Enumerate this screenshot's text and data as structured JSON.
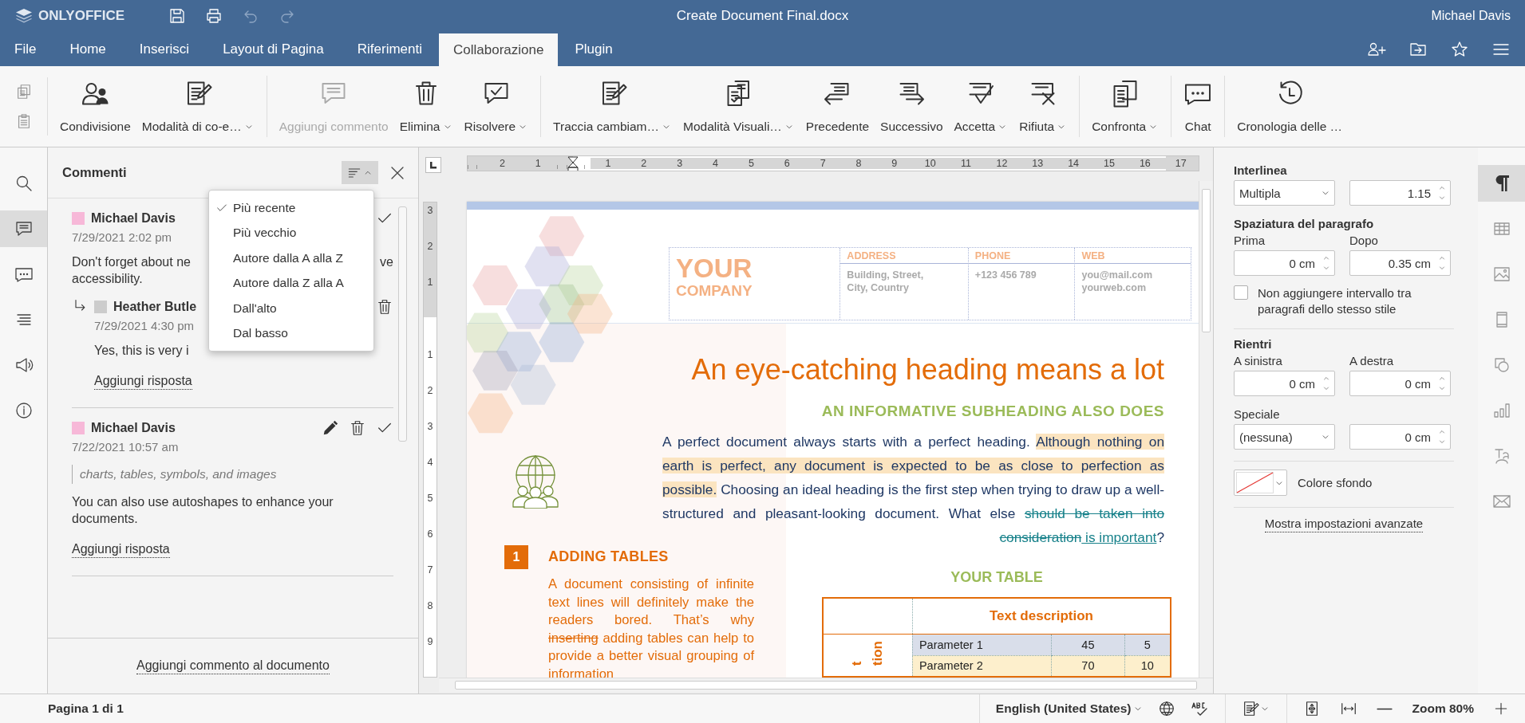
{
  "app": {
    "logo": "ONLYOFFICE",
    "title": "Create Document Final.docx",
    "user": "Michael Davis"
  },
  "quick_actions": [
    {
      "kind": "save",
      "disabled": false
    },
    {
      "kind": "print",
      "disabled": false
    },
    {
      "kind": "undo",
      "disabled": true
    },
    {
      "kind": "redo",
      "disabled": true
    }
  ],
  "tabs": [
    {
      "label": "File",
      "selected": false
    },
    {
      "label": "Home",
      "selected": false
    },
    {
      "label": "Inserisci",
      "selected": false
    },
    {
      "label": "Layout di Pagina",
      "selected": false
    },
    {
      "label": "Riferimenti",
      "selected": false
    },
    {
      "label": "Collaborazione",
      "selected": true
    },
    {
      "label": "Plugin",
      "selected": false
    }
  ],
  "header_actions": [
    {
      "kind": "add-user"
    },
    {
      "kind": "folder"
    },
    {
      "kind": "star"
    },
    {
      "kind": "menu"
    }
  ],
  "toolbar": {
    "clipboard": [
      {
        "kind": "copy"
      },
      {
        "kind": "paste"
      }
    ],
    "groups": [
      [
        {
          "kind": "share",
          "label": "Condivisione",
          "caret": false,
          "disabled": false
        },
        {
          "kind": "coedit",
          "label": "Modalità di co-e…",
          "caret": true,
          "disabled": false
        }
      ],
      [
        {
          "kind": "comment",
          "label": "Aggiungi commento",
          "caret": false,
          "disabled": true
        },
        {
          "kind": "trash",
          "label": "Elimina",
          "caret": true,
          "disabled": false
        },
        {
          "kind": "resolve",
          "label": "Risolvere",
          "caret": true,
          "disabled": false
        }
      ],
      [
        {
          "kind": "track",
          "label": "Traccia cambiam…",
          "caret": true,
          "disabled": false
        },
        {
          "kind": "view",
          "label": "Modalità Visuali…",
          "caret": true,
          "disabled": false
        },
        {
          "kind": "previous",
          "label": "Precedente",
          "caret": false,
          "disabled": false
        },
        {
          "kind": "next",
          "label": "Successivo",
          "caret": false,
          "disabled": false
        },
        {
          "kind": "accept",
          "label": "Accetta",
          "caret": true,
          "disabled": false
        },
        {
          "kind": "reject",
          "label": "Rifiuta",
          "caret": true,
          "disabled": false
        }
      ],
      [
        {
          "kind": "compare",
          "label": "Confronta",
          "caret": true,
          "disabled": false
        }
      ],
      [
        {
          "kind": "chat",
          "label": "Chat",
          "caret": false,
          "disabled": false
        }
      ],
      [
        {
          "kind": "history",
          "label": "Cronologia delle …",
          "caret": false,
          "disabled": false
        }
      ]
    ]
  },
  "left_sidebar": [
    {
      "kind": "search",
      "selected": false
    },
    {
      "kind": "comments",
      "selected": true
    },
    {
      "kind": "chat",
      "selected": false
    },
    {
      "kind": "navigation",
      "selected": false
    },
    {
      "kind": "feedback",
      "selected": false
    },
    {
      "kind": "about",
      "selected": false
    }
  ],
  "comments_panel": {
    "title": "Commenti",
    "sort_menu": [
      {
        "label": "Più recente",
        "selected": true
      },
      {
        "label": "Più vecchio",
        "selected": false
      },
      {
        "label": "Autore dalla A alla Z",
        "selected": false
      },
      {
        "label": "Autore dalla Z alla A",
        "selected": false
      },
      {
        "label": "Dall'alto",
        "selected": false
      },
      {
        "label": "Dal basso",
        "selected": false
      }
    ],
    "comments": [
      {
        "author": "Michael Davis",
        "color": "#f7b8d8",
        "date": "7/29/2021 2:02 pm",
        "text_rows": [
          [
            "Don't forget about ne",
            "ve"
          ],
          [
            "accessibility."
          ]
        ],
        "actions": [
          {
            "kind": "resolve"
          }
        ],
        "replies": [
          {
            "author": "Heather Butle",
            "color": "#cccccc",
            "date": "7/29/2021 4:30 pm",
            "text": "Yes, this is very i",
            "actions": [
              {
                "kind": "delete"
              }
            ]
          }
        ],
        "reply_link": "Aggiungi risposta"
      },
      {
        "author": "Michael Davis",
        "color": "#f7b8d8",
        "date": "7/22/2021 10:57 am",
        "quote": "charts, tables, symbols, and images",
        "text": "You can also use autoshapes to enhance your documents.",
        "actions": [
          {
            "kind": "edit"
          },
          {
            "kind": "delete"
          },
          {
            "kind": "resolve"
          }
        ],
        "reply_link": "Aggiungi risposta"
      }
    ],
    "add_comment": "Aggiungi commento al documento"
  },
  "document": {
    "ruler_top_before": [
      "2",
      "1"
    ],
    "ruler_top_after": [
      "1",
      "2",
      "3",
      "4",
      "5",
      "6",
      "7",
      "8",
      "9",
      "10",
      "11",
      "12",
      "13",
      "14",
      "15",
      "16",
      "17"
    ],
    "ruler_side_before": [
      "3",
      "2",
      "1"
    ],
    "ruler_side_after": [
      "1",
      "2",
      "3",
      "4",
      "5",
      "6",
      "7",
      "8",
      "9"
    ],
    "company": [
      "YOUR",
      "COMPANY"
    ],
    "contacts": [
      {
        "title": "ADDRESS",
        "lines": [
          "Building, Street,",
          "City, Country"
        ]
      },
      {
        "title": "PHONE",
        "lines": [
          "+123 456 789"
        ]
      },
      {
        "title": "WEB",
        "lines": [
          "you@mail.com",
          "yourweb.com"
        ]
      }
    ],
    "heading": "An eye-catching heading means a lot",
    "subheading": "AN INFORMATIVE SUBHEADING ALSO DOES",
    "paragraph": [
      {
        "kind": "normal",
        "text": "A perfect document always starts with a perfect heading. "
      },
      {
        "kind": "highlight",
        "text": "Although nothing on earth is perfect, any document is expected to be as close to perfection as possible."
      },
      {
        "kind": "normal",
        "text": " Choosing an ideal heading is the first step when trying to draw up a well-structured and pleasant-looking document. What else "
      },
      {
        "kind": "deleted",
        "text": "should be taken into consideration"
      },
      {
        "kind": "inserted",
        "text": " is important"
      },
      {
        "kind": "normal",
        "text": "?"
      }
    ],
    "section": {
      "number": "1",
      "title": "ADDING TABLES",
      "paragraph": [
        {
          "kind": "normal",
          "text": "A document consisting of infinite text lines will definitely make the readers bored. That’s why "
        },
        {
          "kind": "deleted",
          "text": "inserting"
        },
        {
          "kind": "normal",
          "text": " adding tables can help to provide a better visual grouping of information"
        }
      ]
    },
    "table": {
      "title": "YOUR TABLE",
      "header": "Text description",
      "side_label": [
        "t",
        "tion"
      ],
      "rows": [
        {
          "cells": [
            "Parameter 1",
            "45",
            "5"
          ],
          "color": "#d9deea"
        },
        {
          "cells": [
            "Parameter 2",
            "70",
            "10"
          ],
          "color": "#fdefcc"
        }
      ]
    }
  },
  "right_panel": {
    "line_spacing_label": "Interlinea",
    "line_spacing_mode": "Multipla",
    "line_spacing_value": "1.15",
    "spacing_label": "Spaziatura del paragrafo",
    "before_label": "Prima",
    "before": "0 cm",
    "after_label": "Dopo",
    "after": "0.35 cm",
    "same_style": {
      "label": "Non aggiungere intervallo tra paragrafi dello stesso stile",
      "checked": false
    },
    "indents_label": "Rientri",
    "left_label": "A sinistra",
    "left": "0 cm",
    "right_label": "A destra",
    "right": "0 cm",
    "special_label": "Speciale",
    "special": "(nessuna)",
    "special_value": "0 cm",
    "background_label": "Colore sfondo",
    "advanced_link": "Mostra impostazioni avanzate"
  },
  "right_sidebar": [
    {
      "kind": "paragraph",
      "selected": true
    },
    {
      "kind": "table",
      "selected": false
    },
    {
      "kind": "image",
      "selected": false
    },
    {
      "kind": "header-footer",
      "selected": false
    },
    {
      "kind": "shape",
      "selected": false
    },
    {
      "kind": "chart",
      "selected": false
    },
    {
      "kind": "text-art",
      "selected": false
    },
    {
      "kind": "mail-merge",
      "selected": false
    }
  ],
  "status_bar": {
    "page": "Pagina 1 di 1",
    "language": "English (United States)",
    "zoom": "Zoom 80%"
  }
}
